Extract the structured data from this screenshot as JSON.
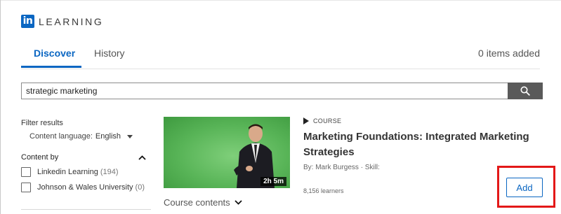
{
  "header": {
    "logo_mark": "in",
    "logo_text": "LEARNING"
  },
  "tabs": {
    "discover": "Discover",
    "history": "History",
    "items_added": "0 items added"
  },
  "search": {
    "value": "strategic marketing"
  },
  "filters": {
    "title": "Filter results",
    "language_label": "Content language:",
    "language_value": "English",
    "content_by_label": "Content by",
    "providers": [
      {
        "name": "Linkedin Learning",
        "count": "(194)"
      },
      {
        "name": "Johnson & Wales University",
        "count": "(0)"
      }
    ]
  },
  "course": {
    "type_label": "COURSE",
    "title": "Marketing Foundations: Integrated Marketing Strategies",
    "byline": "By: Mark Burgess  ·  Skill:",
    "learners": "8,156 learners",
    "duration": "2h 5m",
    "contents_label": "Course contents",
    "add_label": "Add"
  },
  "colors": {
    "accent": "#0a66c2",
    "highlight": "#e31818",
    "thumbnail_bg": "#58b457"
  }
}
